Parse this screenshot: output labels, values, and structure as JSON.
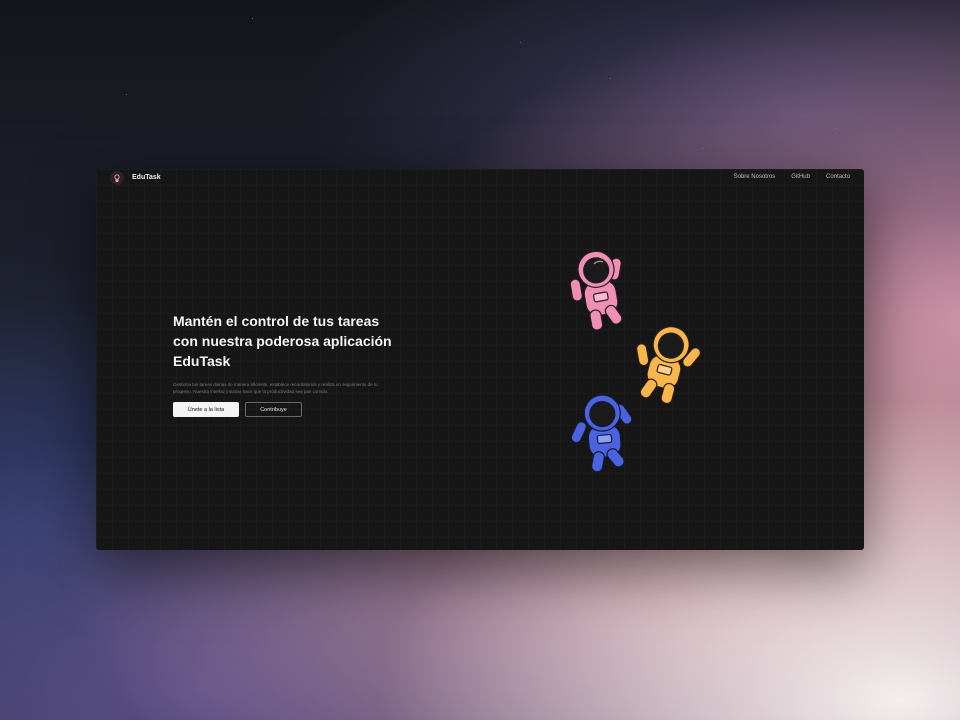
{
  "nav": {
    "brand": "EduTask",
    "logo_icon": "astronaut-logo-icon",
    "links": [
      {
        "label": "Sobre Nosotros"
      },
      {
        "label": "GitHub"
      },
      {
        "label": "Contacto"
      }
    ]
  },
  "hero": {
    "title_lines": [
      "Mantén el control de tus tareas",
      "con nuestra poderosa aplicación",
      "EduTask"
    ],
    "subtitle_lines": [
      "Gestiona tus tareas diarias de manera eficiente, establece recordatorios y realiza un seguimiento de tu",
      "progreso. Nuestra interfaz intuitiva hace que la productividad sea pan comido."
    ],
    "primary_button": "Únete a la lista",
    "secondary_button": "Contribuye"
  },
  "illustration": {
    "astronauts": [
      {
        "name": "pink-astronaut-icon",
        "color": "#f08fb5"
      },
      {
        "name": "orange-astronaut-icon",
        "color": "#f9b64c"
      },
      {
        "name": "blue-astronaut-icon",
        "color": "#4b63df"
      }
    ]
  },
  "colors": {
    "window_bg": "#161616",
    "primary_button_bg": "#f4f4f4",
    "text": "#f5f5f5"
  }
}
